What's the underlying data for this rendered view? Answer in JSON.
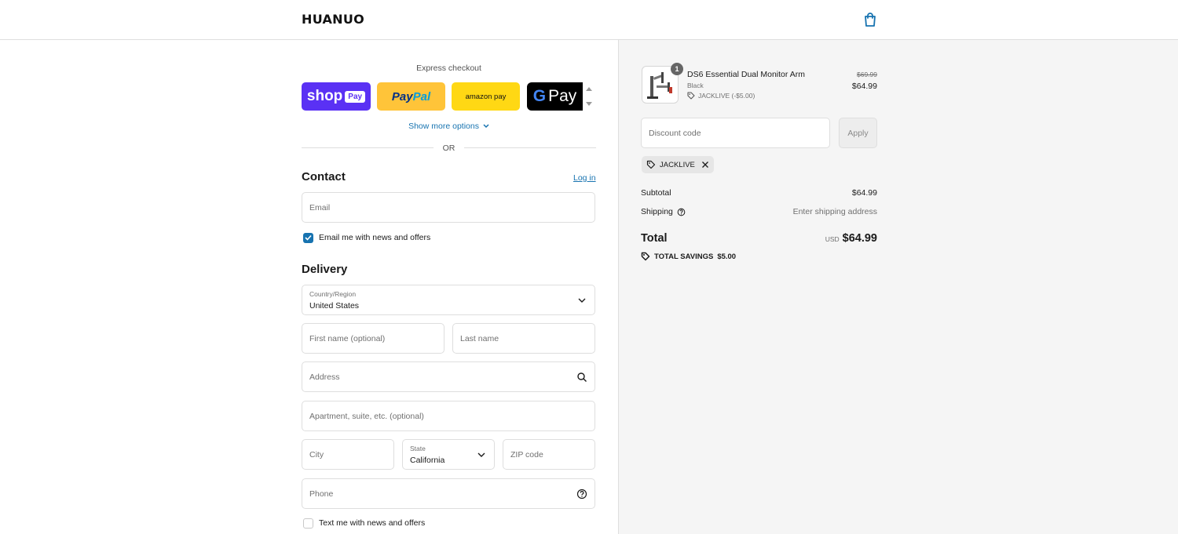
{
  "header": {
    "logo": "HUANUO"
  },
  "express": {
    "label": "Express checkout",
    "shop_label": "shop",
    "shop_pill": "Pay",
    "paypal_1": "Pay",
    "paypal_2": "Pal",
    "amazon_label": "amazon pay",
    "gpay_g": "G",
    "gpay_label": "Pay",
    "show_more": "Show more options",
    "or": "OR"
  },
  "contact": {
    "heading": "Contact",
    "login": "Log in",
    "email_placeholder": "Email",
    "news_checkbox_label": "Email me with news and offers",
    "news_checked": true
  },
  "delivery": {
    "heading": "Delivery",
    "country_label": "Country/Region",
    "country_value": "United States",
    "first_name_placeholder": "First name (optional)",
    "last_name_placeholder": "Last name",
    "address_placeholder": "Address",
    "apartment_placeholder": "Apartment, suite, etc. (optional)",
    "city_placeholder": "City",
    "state_label": "State",
    "state_value": "California",
    "zip_placeholder": "ZIP code",
    "phone_placeholder": "Phone",
    "sms_checkbox_label": "Text me with news and offers",
    "sms_checked": false
  },
  "summary": {
    "product": {
      "quantity": "1",
      "name": "DS6 Essential Dual Monitor Arm",
      "variant": "Black",
      "discount_line": "JACKLIVE (-$5.00)",
      "price_old": "$69.99",
      "price_new": "$64.99"
    },
    "discount_placeholder": "Discount code",
    "apply_label": "Apply",
    "applied_code": "JACKLIVE",
    "subtotal_label": "Subtotal",
    "subtotal_value": "$64.99",
    "shipping_label": "Shipping",
    "shipping_value": "Enter shipping address",
    "total_label": "Total",
    "total_currency": "USD",
    "total_value": "$64.99",
    "savings_label": "TOTAL SAVINGS",
    "savings_value": "$5.00"
  },
  "colors": {
    "link": "#1773b0",
    "shop_pay": "#5a31f4",
    "paypal": "#ffc439",
    "amazon": "#ffd814",
    "summary_bg": "#f5f5f5"
  }
}
